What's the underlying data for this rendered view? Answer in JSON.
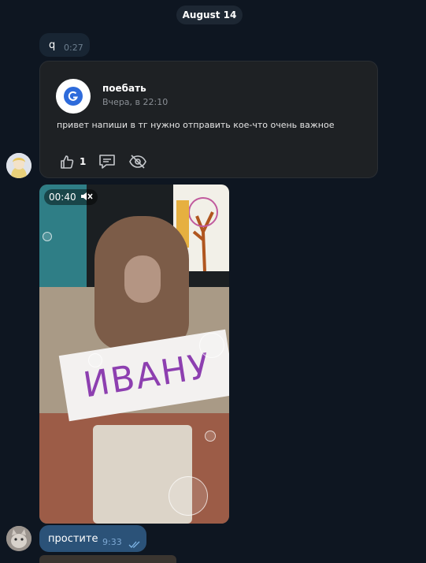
{
  "date_separator": "August 14",
  "message_q": {
    "text": "q",
    "time": "0:27"
  },
  "card": {
    "sender_name": "поебать",
    "sender_date": "Вчера, в 22:10",
    "body": "привет напиши в тг нужно отправить кое-что очень важное",
    "like_count": "1"
  },
  "video": {
    "duration": "00:40",
    "sign_text": "ИВАНУ"
  },
  "message_out": {
    "text": "простите",
    "time": "9:33"
  },
  "colors": {
    "background": "#0e1621",
    "incoming_bubble": "#182533",
    "outgoing_bubble": "#2b5278",
    "card_bg": "#1e2124"
  }
}
